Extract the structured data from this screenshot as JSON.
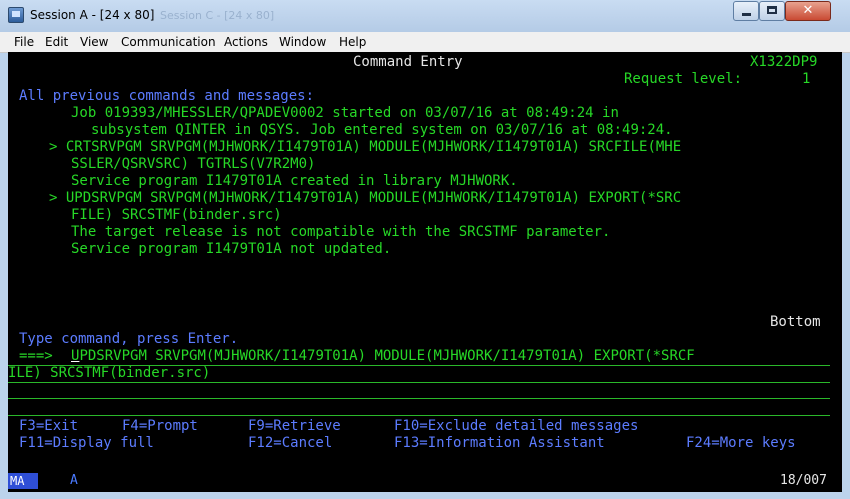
{
  "window": {
    "title": "Session A - [24 x 80]",
    "ghost_text": "Session C - [24 x 80]",
    "close_glyph": "✕"
  },
  "menu": [
    "File",
    "Edit",
    "View",
    "Communication",
    "Actions",
    "Window",
    "Help"
  ],
  "screen": {
    "header": {
      "title": "Command Entry",
      "system": "X1322DP9",
      "request_level_label": "Request level:",
      "request_level_value": "1"
    },
    "section_label": "All previous commands and messages:",
    "messages": [
      "Job 019393/MHESSLER/QPADEV0002 started on 03/07/16 at 08:49:24 in",
      "subsystem QINTER in QSYS. Job entered system on 03/07/16 at 08:49:24.",
      "> CRTSRVPGM SRVPGM(MJHWORK/I1479T01A) MODULE(MJHWORK/I1479T01A) SRCFILE(MHE",
      "SSLER/QSRVSRC) TGTRLS(V7R2M0)",
      "Service program I1479T01A created in library MJHWORK.",
      "> UPDSRVPGM SRVPGM(MJHWORK/I1479T01A) MODULE(MJHWORK/I1479T01A) EXPORT(*SRC",
      "FILE) SRCSTMF(binder.src)",
      "The target release is not compatible with the SRCSTMF parameter.",
      "Service program I1479T01A not updated."
    ],
    "bottom_label": "Bottom",
    "prompt_label": "Type command, press Enter.",
    "prompt_arrow": "===>",
    "command_first_char": "U",
    "command_rest": "PDSRVPGM SRVPGM(MJHWORK/I1479T01A) MODULE(MJHWORK/I1479T01A) EXPORT(*SRCF",
    "command_line2": "ILE) SRCSTMF(binder.src)",
    "function_keys_row1": [
      "F3=Exit",
      "F4=Prompt",
      "F9=Retrieve",
      "F10=Exclude detailed messages"
    ],
    "function_keys_row2": [
      "F11=Display full",
      "F12=Cancel",
      "F13=Information Assistant",
      "F24=More keys"
    ]
  },
  "status": {
    "indicator": "MA",
    "shift": "A",
    "cursor_pos": "18/007"
  }
}
